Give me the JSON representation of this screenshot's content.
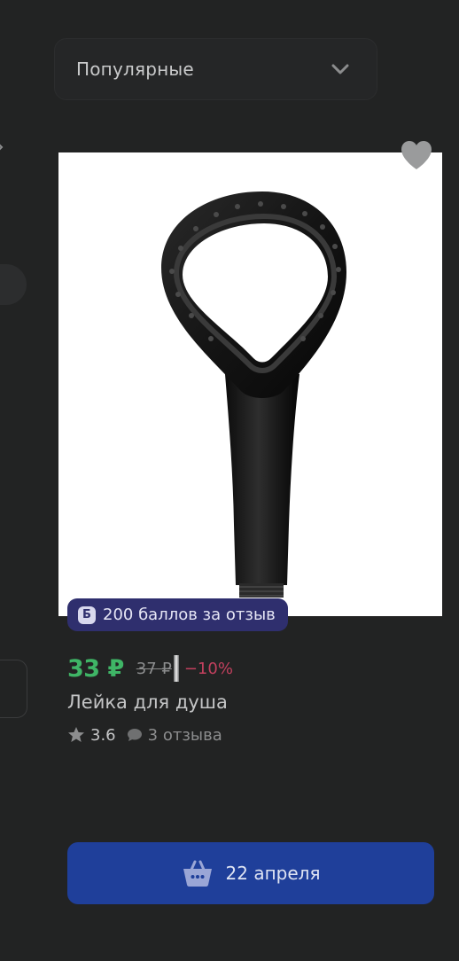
{
  "sort": {
    "selected": "Популярные",
    "icon": "chevron-down-icon"
  },
  "product": {
    "bonus_badge": {
      "icon_letter": "Б",
      "text": "200 баллов за отзыв"
    },
    "price": {
      "current": "33 ₽",
      "old": "37 ₽",
      "discount": "−10%"
    },
    "title": "Лейка для душа",
    "rating": {
      "value": "3.6",
      "reviews": "3 отзыва"
    },
    "favorite_icon": "heart-icon"
  },
  "cart": {
    "label": "22 апреля",
    "icon": "basket-icon"
  },
  "colors": {
    "background": "#222323",
    "price_green": "#3fb566",
    "discount_red": "#c2405e",
    "badge_purple": "#2f2f6e",
    "cart_blue": "#1f3f9a"
  }
}
